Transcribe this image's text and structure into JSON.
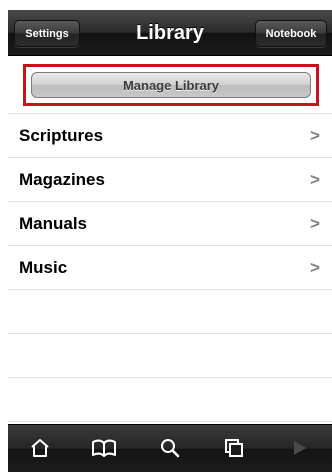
{
  "navbar": {
    "left_button": "Settings",
    "title": "Library",
    "right_button": "Notebook"
  },
  "manage": {
    "button_label": "Manage Library",
    "highlight_color": "#c6131b"
  },
  "list": {
    "items": [
      {
        "label": "Scriptures",
        "chevron": ">"
      },
      {
        "label": "Magazines",
        "chevron": ">"
      },
      {
        "label": "Manuals",
        "chevron": ">"
      },
      {
        "label": "Music",
        "chevron": ">"
      }
    ]
  },
  "tabbar": {
    "icons": [
      "home-icon",
      "book-icon",
      "search-icon",
      "copy-icon",
      "play-icon"
    ]
  }
}
